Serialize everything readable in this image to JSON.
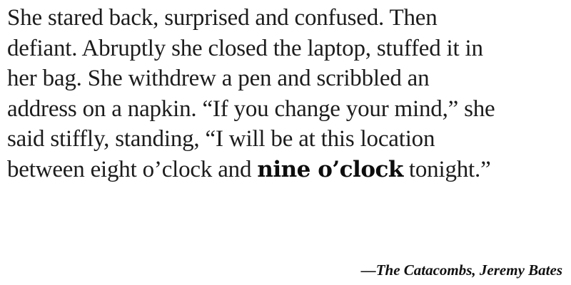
{
  "quote": {
    "lines": [
      "She stared back, surprised and confused. Then",
      "defiant. Abruptly she closed the laptop, stuffed it in",
      "her bag. She withdrew a pen and scribbled an",
      "address on a napkin. “If you change your mind,” she",
      "said stiffly, standing, “I will be at this location"
    ],
    "last_line": {
      "before": "between eight o’clock and ",
      "emphasis": "nine o’clock",
      "after": " tonight.”"
    }
  },
  "attribution": "—The Catacombs, Jeremy Bates"
}
